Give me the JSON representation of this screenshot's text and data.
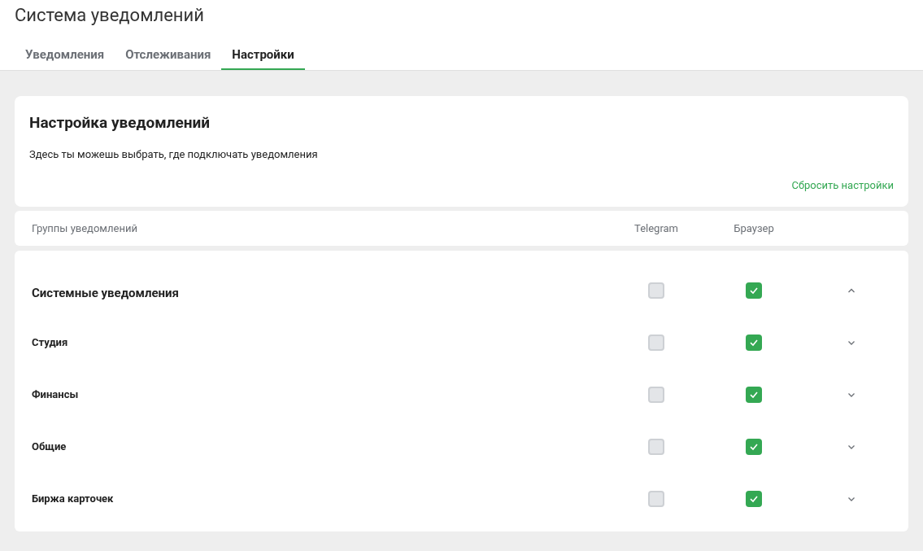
{
  "page_title": "Система уведомлений",
  "tabs": [
    {
      "label": "Уведомления",
      "selected": false
    },
    {
      "label": "Отслеживания",
      "selected": false
    },
    {
      "label": "Настройки",
      "selected": true
    }
  ],
  "settings_card": {
    "title": "Настройка уведомлений",
    "description": "Здесь ты можешь выбрать, где подключать уведомления",
    "reset_link": "Сбросить настройки"
  },
  "table": {
    "columns": [
      "Группы уведомлений",
      "Telegram",
      "Браузер"
    ],
    "rows": [
      {
        "kind": "group",
        "name": "Системные уведомления",
        "telegram": false,
        "browser": true,
        "expanded": true
      },
      {
        "kind": "item",
        "name": "Студия",
        "telegram": false,
        "browser": true,
        "expanded": false
      },
      {
        "kind": "item",
        "name": "Финансы",
        "telegram": false,
        "browser": true,
        "expanded": false
      },
      {
        "kind": "item",
        "name": "Общие",
        "telegram": false,
        "browser": true,
        "expanded": false
      },
      {
        "kind": "item",
        "name": "Биржа карточек",
        "telegram": false,
        "browser": true,
        "expanded": false
      }
    ]
  }
}
